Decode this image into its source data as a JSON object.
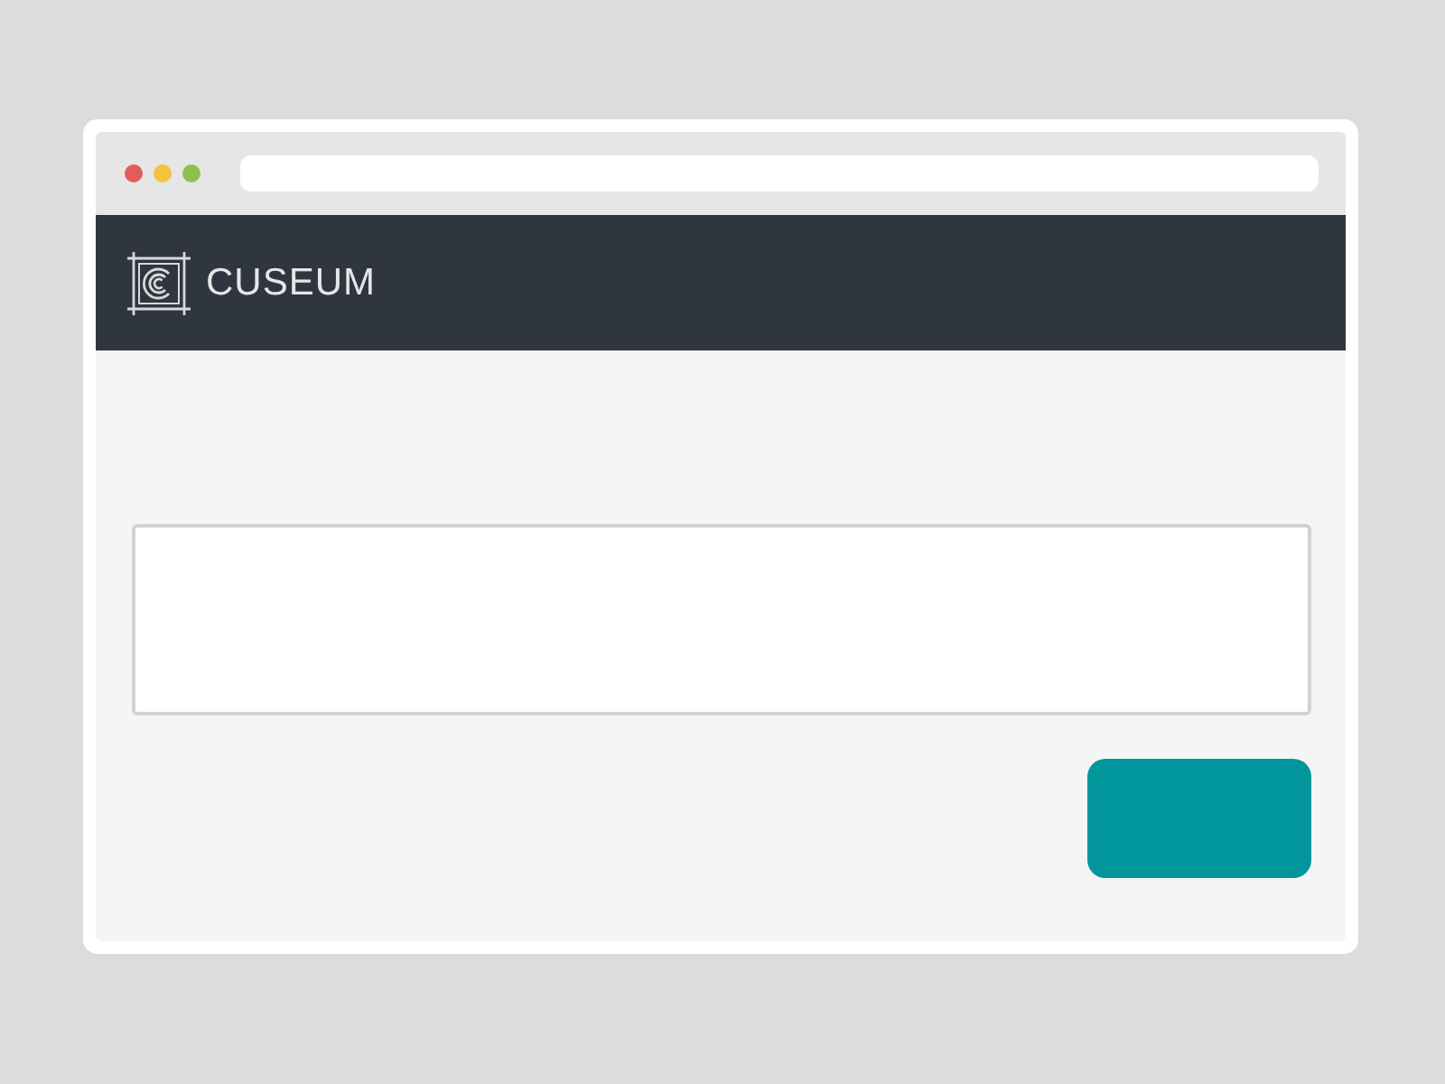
{
  "header": {
    "brand": "CUSEUM"
  }
}
